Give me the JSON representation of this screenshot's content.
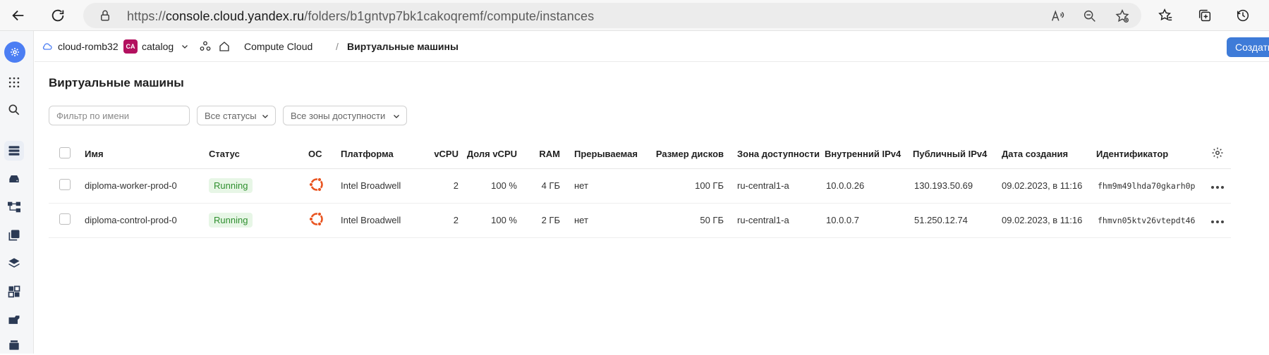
{
  "browser": {
    "url_prefix": "https://",
    "url_host": "console.cloud.yandex.ru",
    "url_path": "/folders/b1gntvp7bk1cakoqremf/compute/instances"
  },
  "header": {
    "cloud": "cloud-romb32",
    "folder_badge": "CA",
    "folder": "catalog",
    "service": "Compute Cloud",
    "separator": "/",
    "page": "Виртуальные машины",
    "create_label": "Создать"
  },
  "main": {
    "title": "Виртуальные машины",
    "filter_name_placeholder": "Фильтр по имени",
    "filter_status": "Все статусы",
    "filter_zone": "Все зоны доступности"
  },
  "table": {
    "columns": [
      "Имя",
      "Статус",
      "ОС",
      "Платформа",
      "vCPU",
      "Доля vCPU",
      "RAM",
      "Прерываемая",
      "Размер дисков",
      "Зона доступности",
      "Внутренний IPv4",
      "Публичный IPv4",
      "Дата создания",
      "Идентификатор"
    ],
    "rows": [
      {
        "name": "diploma-worker-prod-0",
        "status": "Running",
        "os_icon": "ubuntu-icon",
        "platform": "Intel Broadwell",
        "vcpu": "2",
        "vcpu_share": "100 %",
        "ram": "4 ГБ",
        "preemptible": "нет",
        "disk_size": "100 ГБ",
        "zone": "ru-central1-a",
        "internal_ip": "10.0.0.26",
        "public_ip": "130.193.50.69",
        "created": "09.02.2023, в 11:16",
        "id": "fhm9m49lhda70gkarh0p"
      },
      {
        "name": "diploma-control-prod-0",
        "status": "Running",
        "os_icon": "ubuntu-icon",
        "platform": "Intel Broadwell",
        "vcpu": "2",
        "vcpu_share": "100 %",
        "ram": "2 ГБ",
        "preemptible": "нет",
        "disk_size": "50 ГБ",
        "zone": "ru-central1-a",
        "internal_ip": "10.0.0.7",
        "public_ip": "51.250.12.74",
        "created": "09.02.2023, в 11:16",
        "id": "fhmvn05ktv26vtepdt46"
      }
    ]
  },
  "colors": {
    "accent": "#3e7bd8",
    "status_running_bg": "#e7f6e6",
    "status_running_text": "#2f8f2f",
    "ubuntu": "#e95420",
    "folder_badge": "#b3115f"
  }
}
